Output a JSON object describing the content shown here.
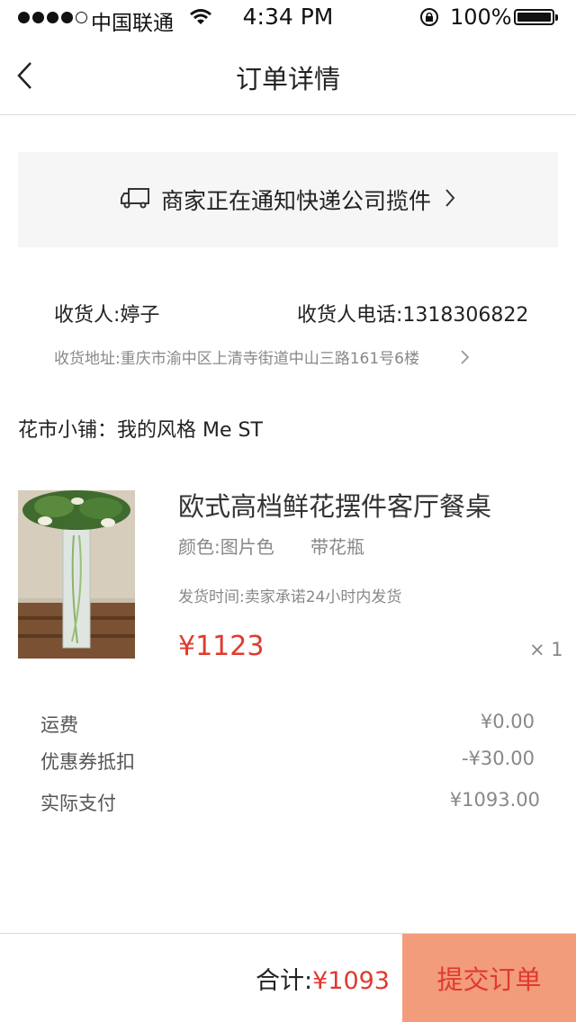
{
  "status_bar": {
    "carrier": "中国联通",
    "time": "4:34 PM",
    "battery": "100%"
  },
  "nav": {
    "title": "订单详情"
  },
  "shipping": {
    "status": "商家正在通知快递公司揽件"
  },
  "address": {
    "recipient": "收货人:婷子",
    "phone": "收货人电话:1318306822",
    "address": "收货地址:重庆市渝中区上清寺街道中山三路161号6楼"
  },
  "shop": {
    "name": "花市小铺：我的风格 Me ST"
  },
  "product": {
    "title": "欧式高档鲜花摆件客厅餐桌",
    "color": "颜色:图片色",
    "option": "带花瓶",
    "ship_time": "发货时间:卖家承诺24小时内发货",
    "price": "¥1123",
    "quantity": "× 1"
  },
  "fees": {
    "shipping_label": "运费",
    "shipping_value": "¥0.00",
    "coupon_label": "优惠券抵扣",
    "coupon_value": "-¥30.00",
    "actual_label": "实际支付",
    "actual_value": "¥1093.00"
  },
  "footer": {
    "total_label": "合计:",
    "total_value": "¥1093",
    "submit": "提交订单"
  },
  "colors": {
    "accent_red": "#e03a2e",
    "submit_bg": "#f29c7b",
    "banner_bg": "#f6f6f6"
  }
}
